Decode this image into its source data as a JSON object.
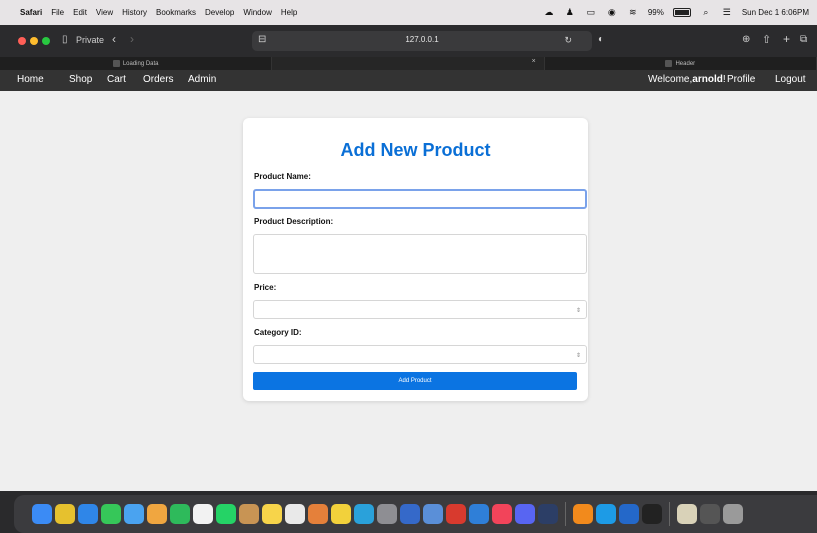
{
  "menubar": {
    "apple": "",
    "app": "Safari",
    "items": [
      "File",
      "Edit",
      "View",
      "History",
      "Bookmarks",
      "Develop",
      "Window",
      "Help"
    ],
    "battery_percent": "99%",
    "battery_level": 0.99,
    "clock": "Sun Dec 1 6:06PM"
  },
  "toolbar": {
    "private_label": "Private",
    "url": "127.0.0.1"
  },
  "tabs": [
    {
      "label": "Loading Data"
    },
    {
      "label": ""
    },
    {
      "label": "Header"
    }
  ],
  "nav": {
    "home": "Home",
    "shop": "Shop",
    "cart": "Cart",
    "orders": "Orders",
    "admin": "Admin",
    "welcome_prefix": "Welcome,",
    "username": "arnold",
    "welcome_suffix": "!",
    "profile": "Profile",
    "logout": "Logout"
  },
  "form": {
    "title": "Add New Product",
    "product_name_label": "Product Name:",
    "product_name_value": "",
    "description_label": "Product Description:",
    "description_value": "",
    "price_label": "Price:",
    "price_value": "",
    "category_label": "Category ID:",
    "category_value": "",
    "submit_label": "Add Product"
  },
  "colors": {
    "accent": "#0b74e2",
    "title": "#0a6fd6",
    "navbar": "#333333"
  }
}
